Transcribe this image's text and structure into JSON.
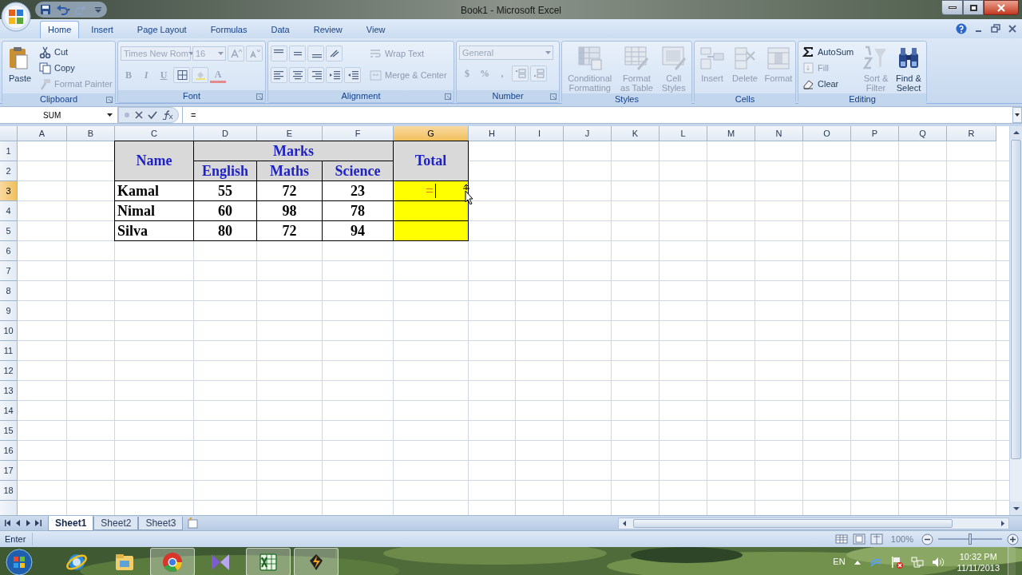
{
  "window": {
    "title": "Book1 - Microsoft Excel"
  },
  "ribbon_tabs": [
    {
      "label": "Home",
      "selected": true
    },
    {
      "label": "Insert",
      "selected": false
    },
    {
      "label": "Page Layout",
      "selected": false
    },
    {
      "label": "Formulas",
      "selected": false
    },
    {
      "label": "Data",
      "selected": false
    },
    {
      "label": "Review",
      "selected": false
    },
    {
      "label": "View",
      "selected": false
    }
  ],
  "ribbon_groups": [
    {
      "title": "Clipboard",
      "items": [
        {
          "kind": "large",
          "label": "Paste",
          "disabled": false
        },
        {
          "kind": "small",
          "label": "Cut",
          "disabled": false
        },
        {
          "kind": "small",
          "label": "Copy",
          "disabled": false
        },
        {
          "kind": "small",
          "label": "Format Painter",
          "disabled": true
        }
      ]
    },
    {
      "title": "Font",
      "items": [
        {
          "kind": "combo",
          "label": "Times New Rom",
          "disabled": true
        },
        {
          "kind": "combo",
          "label": "16",
          "disabled": true
        },
        {
          "kind": "glyph",
          "label": "B",
          "disabled": true
        },
        {
          "kind": "glyph",
          "label": "I",
          "disabled": true
        },
        {
          "kind": "glyph",
          "label": "U",
          "disabled": true
        },
        {
          "kind": "glyph",
          "label": "A",
          "disabled": true
        }
      ]
    },
    {
      "title": "Alignment",
      "items": [
        {
          "kind": "small",
          "label": "Wrap Text",
          "disabled": true
        },
        {
          "kind": "small",
          "label": "Merge & Center",
          "disabled": true
        }
      ]
    },
    {
      "title": "Number",
      "items": [
        {
          "kind": "combo",
          "label": "General",
          "disabled": true
        },
        {
          "kind": "glyph",
          "label": "$",
          "disabled": true
        },
        {
          "kind": "glyph",
          "label": "%",
          "disabled": true
        },
        {
          "kind": "glyph",
          "label": ",",
          "disabled": true
        }
      ]
    },
    {
      "title": "Styles",
      "items": [
        {
          "kind": "large",
          "label": "Conditional Formatting",
          "disabled": true
        },
        {
          "kind": "large",
          "label": "Format as Table",
          "disabled": true
        },
        {
          "kind": "large",
          "label": "Cell Styles",
          "disabled": true
        }
      ]
    },
    {
      "title": "Cells",
      "items": [
        {
          "kind": "large",
          "label": "Insert",
          "disabled": true
        },
        {
          "kind": "large",
          "label": "Delete",
          "disabled": true
        },
        {
          "kind": "large",
          "label": "Format",
          "disabled": true
        }
      ]
    },
    {
      "title": "Editing",
      "items": [
        {
          "kind": "small",
          "label": "AutoSum",
          "disabled": false
        },
        {
          "kind": "small",
          "label": "Fill",
          "disabled": true
        },
        {
          "kind": "small",
          "label": "Clear",
          "disabled": false
        },
        {
          "kind": "large",
          "label": "Sort & Filter",
          "disabled": true
        },
        {
          "kind": "large",
          "label": "Find & Select",
          "disabled": false
        }
      ]
    }
  ],
  "formula_bar": {
    "name_box": "SUM",
    "formula": "="
  },
  "columns": [
    {
      "label": "A",
      "selected": false
    },
    {
      "label": "B",
      "selected": false
    },
    {
      "label": "C",
      "selected": false
    },
    {
      "label": "D",
      "selected": false
    },
    {
      "label": "E",
      "selected": false
    },
    {
      "label": "F",
      "selected": false
    },
    {
      "label": "G",
      "selected": true
    },
    {
      "label": "H",
      "selected": false
    },
    {
      "label": "I",
      "selected": false
    },
    {
      "label": "J",
      "selected": false
    },
    {
      "label": "K",
      "selected": false
    },
    {
      "label": "L",
      "selected": false
    },
    {
      "label": "M",
      "selected": false
    },
    {
      "label": "N",
      "selected": false
    },
    {
      "label": "O",
      "selected": false
    },
    {
      "label": "P",
      "selected": false
    },
    {
      "label": "Q",
      "selected": false
    },
    {
      "label": "R",
      "selected": false
    }
  ],
  "rows": [
    {
      "label": "1",
      "selected": false
    },
    {
      "label": "2",
      "selected": false
    },
    {
      "label": "3",
      "selected": true
    },
    {
      "label": "4",
      "selected": false
    },
    {
      "label": "5",
      "selected": false
    },
    {
      "label": "6",
      "selected": false
    },
    {
      "label": "7",
      "selected": false
    },
    {
      "label": "8",
      "selected": false
    },
    {
      "label": "9",
      "selected": false
    },
    {
      "label": "10",
      "selected": false
    },
    {
      "label": "11",
      "selected": false
    },
    {
      "label": "12",
      "selected": false
    },
    {
      "label": "13",
      "selected": false
    },
    {
      "label": "14",
      "selected": false
    },
    {
      "label": "15",
      "selected": false
    },
    {
      "label": "16",
      "selected": false
    },
    {
      "label": "17",
      "selected": false
    },
    {
      "label": "18",
      "selected": false
    }
  ],
  "table": {
    "headers": [
      "Name",
      "Marks",
      "Total"
    ],
    "subheaders": [
      "English",
      "Maths",
      "Science"
    ],
    "rows": [
      {
        "name": "Kamal",
        "marks": [
          "55",
          "72",
          "23"
        ],
        "total": {
          "kind": "editing",
          "text": "="
        }
      },
      {
        "name": "Nimal",
        "marks": [
          "60",
          "98",
          "78"
        ],
        "total": {
          "kind": "fill"
        }
      },
      {
        "name": "Silva",
        "marks": [
          "80",
          "72",
          "94"
        ],
        "total": {
          "kind": "fill"
        }
      }
    ]
  },
  "sheet_tabs": [
    {
      "label": "Sheet1",
      "selected": true
    },
    {
      "label": "Sheet2",
      "selected": false
    },
    {
      "label": "Sheet3",
      "selected": false
    }
  ],
  "status_bar": {
    "mode": "Enter",
    "zoom": {
      "reading": "100%",
      "level": 0.5
    }
  },
  "taskbar": {
    "language": "EN",
    "time": "10:32 PM",
    "date": "11/11/2013"
  }
}
